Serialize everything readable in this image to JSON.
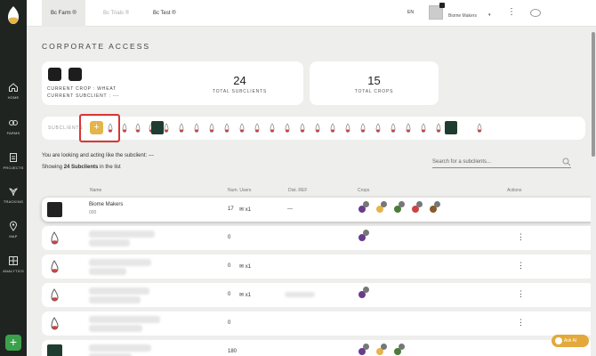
{
  "colors": {
    "sidebar": "#1f2421",
    "accent_green": "#3aa14a",
    "highlight_red": "#d93636",
    "ask_ai": "#e3a93a"
  },
  "sidebar": {
    "items": [
      {
        "label": "HOME",
        "icon": "home-icon"
      },
      {
        "label": "FARMS",
        "icon": "farms-icon"
      },
      {
        "label": "PROJECTS",
        "icon": "projects-icon"
      },
      {
        "label": "TRACKING",
        "icon": "tracking-icon"
      },
      {
        "label": "MAP",
        "icon": "map-pin-icon"
      },
      {
        "label": "ANALYTICS",
        "icon": "grid-icon"
      }
    ],
    "add_label": "+"
  },
  "topbar": {
    "tabs": [
      {
        "label": "Bc Farm ®",
        "active": true
      },
      {
        "label": "Bc Trials ®",
        "active": false
      },
      {
        "label": "Bc Test ®",
        "active": false
      }
    ],
    "language": "EN",
    "user_name": "Biome Makers",
    "user_chevron": "▾",
    "menu_glyph": "⋮"
  },
  "page": {
    "title": "CORPORATE ACCESS",
    "crop_card": {
      "line1": "CURRENT CROP : WHEAT",
      "line2": "CURRENT SUBCLIENT : ---"
    },
    "stats": [
      {
        "value": "24",
        "label": "TOTAL SUBCLIENTS"
      },
      {
        "value": "15",
        "label": "TOTAL CROPS"
      }
    ],
    "subclients_label": "SUBCLIENTS",
    "add_subclient": "+",
    "info_acting": "You are looking and acting like the subclient: ---",
    "info_showing_prefix": "Showing ",
    "info_showing_count": "24 Subclients",
    "info_showing_suffix": " in the list",
    "search_placeholder": "Search for a subclients...",
    "columns": [
      "Name",
      "Num. Users",
      "Dist. REF",
      "Crops",
      "Actions"
    ],
    "rows": [
      {
        "name": "Biome Makers",
        "sub": "000",
        "users": "17",
        "mail": "✉ x1",
        "dist": "---"
      },
      {
        "name": "",
        "sub": "",
        "users": "0",
        "mail": "",
        "dist": ""
      },
      {
        "name": "",
        "sub": "",
        "users": "0",
        "mail": "✉ x1",
        "dist": ""
      },
      {
        "name": "",
        "sub": "",
        "users": "0",
        "mail": "✉ x1",
        "dist": ""
      },
      {
        "name": "",
        "sub": "",
        "users": "0",
        "mail": "",
        "dist": ""
      },
      {
        "name": "",
        "sub": "",
        "users": "180",
        "mail": "",
        "dist": ""
      }
    ],
    "row_menu": "⋮"
  },
  "ask_ai_label": "Ask AI"
}
